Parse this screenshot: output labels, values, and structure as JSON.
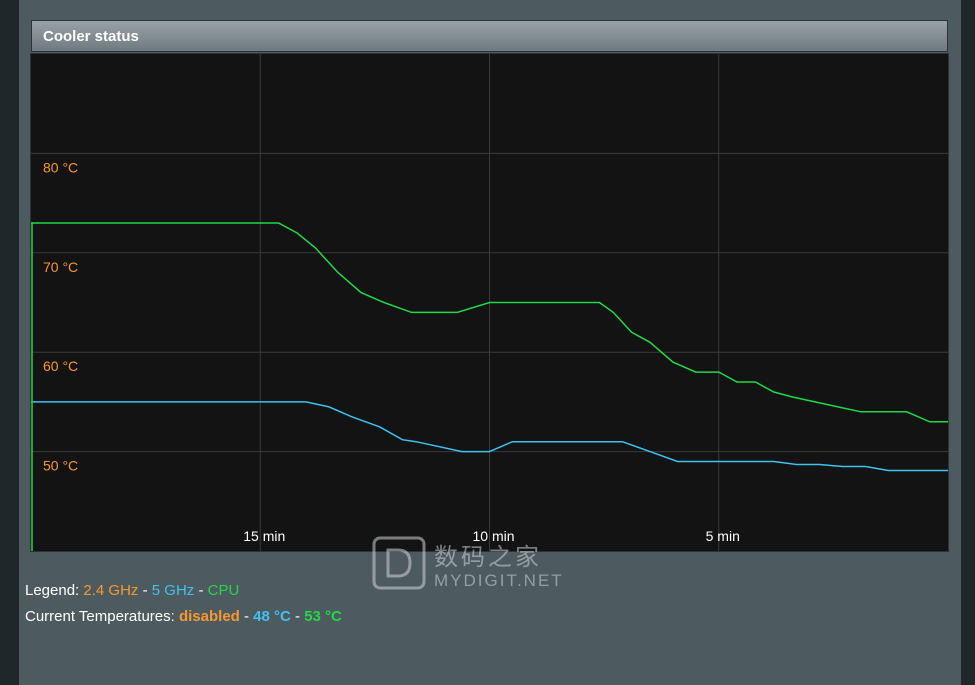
{
  "panel": {
    "title": "Cooler status"
  },
  "chart_data": {
    "type": "line",
    "title": "",
    "xlabel": "",
    "ylabel": "",
    "x_unit": "min",
    "x_range_minutes_ago": [
      20,
      0
    ],
    "ylim": [
      40,
      90
    ],
    "y_ticks": [
      {
        "value": 80,
        "label": "80 °C"
      },
      {
        "value": 70,
        "label": "70 °C"
      },
      {
        "value": 60,
        "label": "60 °C"
      },
      {
        "value": 50,
        "label": "50 °C"
      }
    ],
    "x_ticks": [
      {
        "value": 15,
        "label": "15 min"
      },
      {
        "value": 10,
        "label": "10 min"
      },
      {
        "value": 5,
        "label": "5 min"
      }
    ],
    "grid": true,
    "series": [
      {
        "name": "5 GHz",
        "color": "#3fc1f1",
        "x": [
          20,
          19.2,
          18,
          17,
          16,
          15,
          14,
          13.5,
          13,
          12.4,
          11.9,
          11.6,
          10.6,
          10,
          9.5,
          8.5,
          7.9,
          7.5,
          7.1,
          6.5,
          5.9,
          5.0,
          4.3,
          3.8,
          3.3,
          2.8,
          2.3,
          1.8,
          1.3,
          0.8,
          0
        ],
        "y": [
          55,
          55,
          55,
          55,
          55,
          55,
          55,
          54.5,
          53.5,
          52.5,
          51.2,
          51,
          50,
          50,
          51,
          51,
          51,
          51,
          51,
          50,
          49,
          49,
          49,
          49,
          48.7,
          48.7,
          48.5,
          48.5,
          48.1,
          48.1,
          48.1
        ]
      },
      {
        "name": "CPU",
        "color": "#22d847",
        "x": [
          20,
          19.4,
          18.4,
          17.4,
          16.4,
          15.4,
          14.6,
          14.2,
          13.8,
          13.3,
          12.8,
          12.3,
          11.7,
          11.2,
          10.7,
          10.0,
          9.6,
          9.2,
          8.6,
          8.0,
          7.6,
          7.3,
          6.9,
          6.5,
          6.0,
          5.5,
          5.0,
          4.6,
          4.2,
          3.8,
          3.4,
          2.9,
          2.4,
          1.9,
          1.4,
          0.9,
          0.4,
          0
        ],
        "y": [
          73,
          73,
          73,
          73,
          73,
          73,
          73,
          72,
          70.5,
          68,
          66,
          65,
          64,
          64,
          64,
          65,
          65,
          65,
          65,
          65,
          65,
          64,
          62,
          61,
          59,
          58,
          58,
          57,
          57,
          56,
          55.5,
          55,
          54.5,
          54,
          54,
          54,
          53,
          53
        ]
      }
    ]
  },
  "legend": {
    "prefix": "Legend:",
    "sep1": "-",
    "sep2": "-",
    "items": [
      {
        "label": "2.4 GHz",
        "color": "#f8992e"
      },
      {
        "label": "5 GHz",
        "color": "#3fc1f1"
      },
      {
        "label": "CPU",
        "color": "#22d847"
      }
    ]
  },
  "current_temps": {
    "prefix": "Current Temperatures:",
    "sep1": "-",
    "sep2": "-",
    "band_24": "disabled",
    "band_5": "48 °C",
    "cpu": "53 °C"
  },
  "watermark": {
    "cn": "数码之家",
    "en": "MYDIGIT.NET"
  },
  "colors": {
    "grid": "#3a3a3a",
    "tick_y": "#f8992e",
    "tick_x": "#ffffff",
    "plot_bg": "#131313"
  }
}
